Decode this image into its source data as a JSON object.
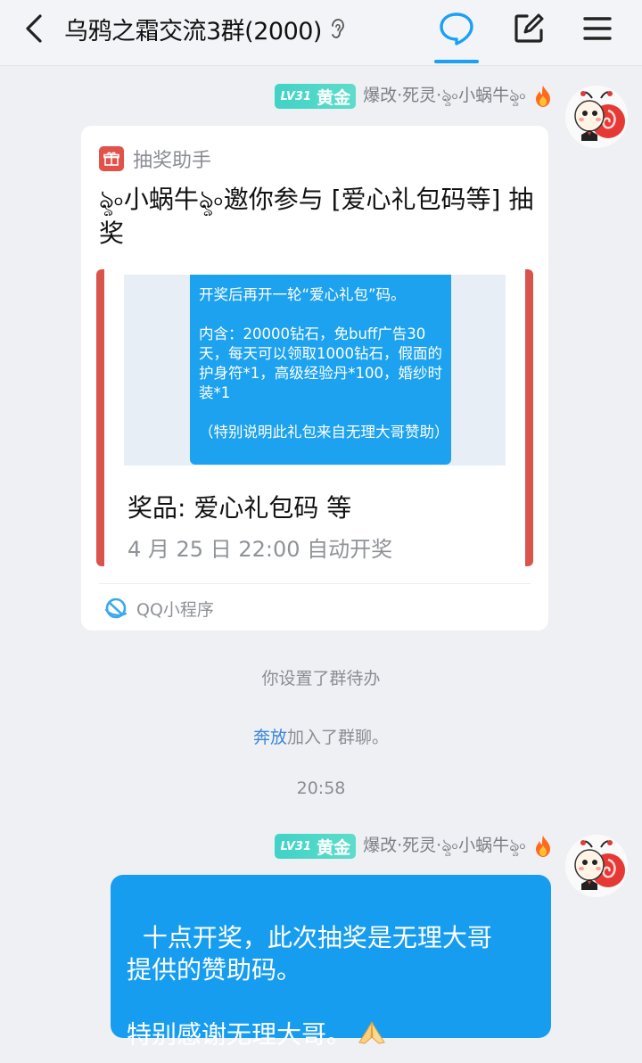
{
  "header": {
    "back_icon": "chevron-left-icon",
    "title": "乌鸦之霜交流3群(2000)",
    "ear_icon": "ear-icon",
    "actions": [
      "chat-bubble-icon",
      "edit-icon",
      "menu-icon"
    ]
  },
  "colors": {
    "accent": "#179df0",
    "level_badge": "#3fd3c6",
    "card_border": "#d9544b",
    "background": "#eef0f4"
  },
  "messages": [
    {
      "sender": {
        "level": "LV31",
        "tier": "黄金",
        "name": "爆改·死灵·ৡ৹小蜗牛ৡ৹",
        "badge_icon": "fire-icon",
        "avatar": "snail-avatar"
      },
      "card": {
        "app_icon": "gift-icon",
        "app_name": "抽奖助手",
        "title": "ৡ৹小蜗牛ৡ৹邀你参与 [爱心礼包码等] 抽奖",
        "image_text": "开奖后再开一轮“爱心礼包”码。\n\n内含：20000钻石，免buff广告30天，每天可以领取1000钻石，假面的护身符*1，高级经验丹*100，婚纱时装*1\n\n（特别说明此礼包来自无理大哥赞助）",
        "prize_label": "奖品: 爱心礼包码 等",
        "draw_time": "4 月 25 日 22:00 自动开奖",
        "footer_icon": "qq-miniprogram-icon",
        "footer_label": "QQ小程序"
      }
    }
  ],
  "notices": {
    "todo": "你设置了群待办",
    "join_name": "奔放",
    "join_suffix": "加入了群聊。",
    "time": "20:58"
  },
  "message2": {
    "sender": {
      "level": "LV31",
      "tier": "黄金",
      "name": "爆改·死灵·ৡ৹小蜗牛ৡ৹"
    },
    "text": "十点开奖，此次抽奖是无理大哥\n提供的赞助码。\n\n特别感谢无理大哥。",
    "emoji": "pray-hands-icon"
  }
}
